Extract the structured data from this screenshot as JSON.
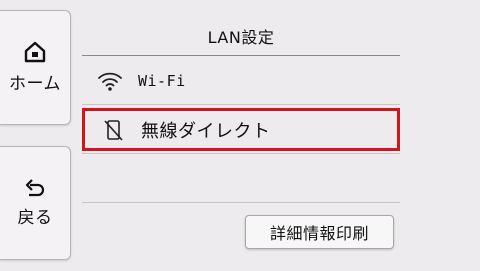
{
  "sidebar": {
    "home_label": "ホーム",
    "home_icon": "home-icon",
    "back_label": "戻る",
    "back_icon": "back-arrow-icon"
  },
  "screen": {
    "title": "LAN設定",
    "items": [
      {
        "label": "Wi-Fi",
        "icon": "wifi-icon"
      },
      {
        "label": "無線ダイレクト",
        "icon": "wireless-direct-icon",
        "selected": true
      }
    ],
    "print_button_label": "詳細情報印刷"
  },
  "colors": {
    "background": "#eeebee",
    "selection_border": "#d4141c"
  }
}
